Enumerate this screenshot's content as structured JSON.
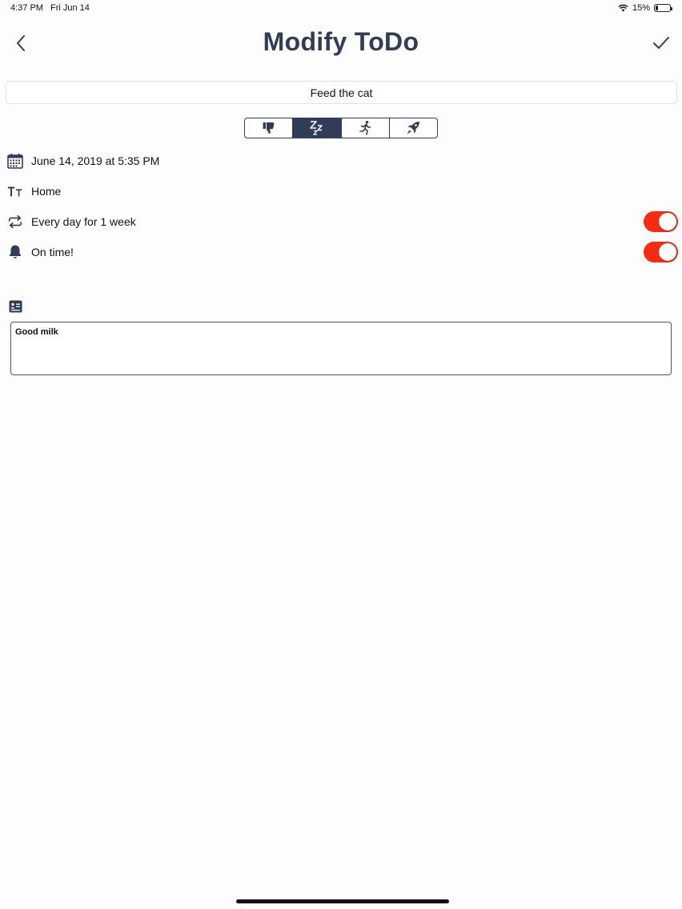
{
  "status_bar": {
    "time": "4:37 PM",
    "date": "Fri Jun 14",
    "battery": "15%",
    "battery_level": 0.15
  },
  "nav": {
    "title": "Modify ToDo",
    "back_icon": "chevron-left-icon",
    "done_icon": "checkmark-icon"
  },
  "todo": {
    "title": "Feed the cat"
  },
  "priority": {
    "segments": [
      {
        "icon": "thumbs-down-icon",
        "selected": false
      },
      {
        "icon": "sleep-zzz-icon",
        "selected": true
      },
      {
        "icon": "running-person-icon",
        "selected": false
      },
      {
        "icon": "rocket-icon",
        "selected": false
      }
    ]
  },
  "rows": {
    "date": {
      "icon": "calendar-icon",
      "label": "June 14, 2019 at 5:35 PM"
    },
    "category": {
      "icon": "text-size-icon",
      "label": "Home"
    },
    "repeat": {
      "icon": "repeat-icon",
      "label": "Every day for 1 week",
      "enabled": true
    },
    "reminder": {
      "icon": "bell-icon",
      "label": "On time!",
      "enabled": true
    }
  },
  "notes": {
    "icon": "notes-card-icon",
    "text": "Good milk"
  },
  "colors": {
    "accent": "#2f3d57",
    "toggle_on": "#f72a12"
  }
}
